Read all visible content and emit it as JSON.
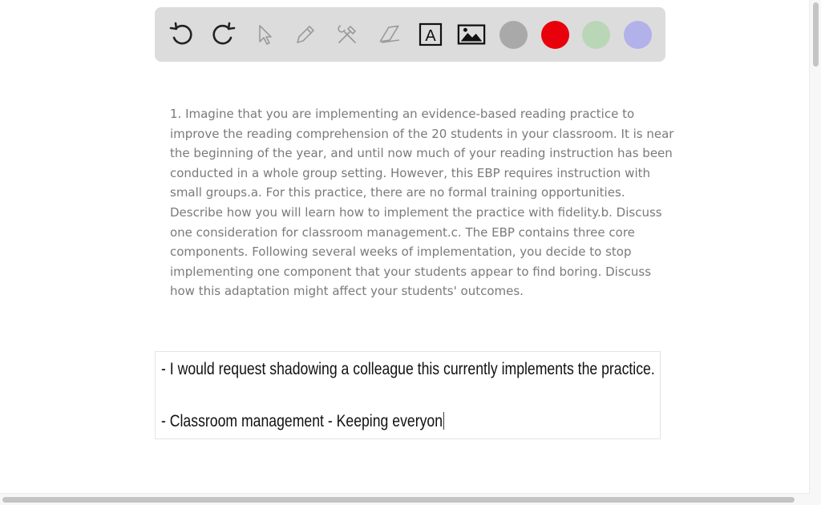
{
  "toolbar": {
    "tools": [
      {
        "name": "undo-icon",
        "enabled": true
      },
      {
        "name": "redo-icon",
        "enabled": true
      },
      {
        "name": "pointer-icon",
        "enabled": false
      },
      {
        "name": "pencil-icon",
        "enabled": false
      },
      {
        "name": "tools-icon",
        "enabled": false
      },
      {
        "name": "eraser-icon",
        "enabled": false
      },
      {
        "name": "text-icon",
        "enabled": true
      },
      {
        "name": "image-icon",
        "enabled": true
      }
    ],
    "text_tool_glyph": "A",
    "colors": [
      "#a9a9a9",
      "#e8000b",
      "#b9d7b6",
      "#b3b1ea"
    ]
  },
  "question": {
    "lines": [
      "1. Imagine that you are implementing an evidence-based reading practice to",
      "improve the reading comprehension of the 20 students in your classroom. It is near",
      "the beginning of the year, and until now much of your reading instruction has been",
      "conducted in a whole group setting. However, this EBP requires instruction with",
      "small groups.a. For this practice, there are no formal training opportunities.",
      "Describe how you will learn how to implement the practice with fidelity.b. Discuss",
      "one consideration for classroom management.c. The EBP contains three core",
      "components. Following several weeks of implementation, you decide to stop",
      "implementing one component that your students appear to find boring. Discuss",
      "how this adaptation might affect your students' outcomes."
    ]
  },
  "answer": {
    "line1": "- I would request shadowing a colleague this currently implements the practice.",
    "line2": "- Classroom management - Keeping everyon"
  }
}
